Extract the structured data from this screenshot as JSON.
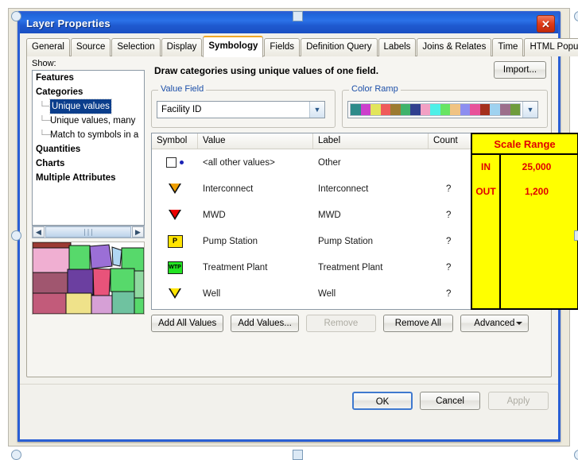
{
  "window": {
    "title": "Layer Properties",
    "close_icon": "close-icon"
  },
  "tabs": [
    {
      "label": "General",
      "active": false
    },
    {
      "label": "Source",
      "active": false
    },
    {
      "label": "Selection",
      "active": false
    },
    {
      "label": "Display",
      "active": false
    },
    {
      "label": "Symbology",
      "active": true
    },
    {
      "label": "Fields",
      "active": false
    },
    {
      "label": "Definition Query",
      "active": false
    },
    {
      "label": "Labels",
      "active": false
    },
    {
      "label": "Joins & Relates",
      "active": false
    },
    {
      "label": "Time",
      "active": false
    },
    {
      "label": "HTML Popup",
      "active": false
    }
  ],
  "show_panel": {
    "caption": "Show:",
    "items": [
      {
        "label": "Features",
        "type": "group",
        "selected": false
      },
      {
        "label": "Categories",
        "type": "group",
        "selected": false
      },
      {
        "label": "Unique values",
        "type": "child",
        "selected": true
      },
      {
        "label": "Unique values, many",
        "type": "child",
        "selected": false
      },
      {
        "label": "Match to symbols in a",
        "type": "child",
        "selected": false
      },
      {
        "label": "Quantities",
        "type": "group",
        "selected": false
      },
      {
        "label": "Charts",
        "type": "group",
        "selected": false
      },
      {
        "label": "Multiple Attributes",
        "type": "group",
        "selected": false
      }
    ],
    "scrollbar": {
      "left_arrow": "◀",
      "right_arrow": "▶",
      "thumb_grip": "∣∣∣"
    }
  },
  "symbology": {
    "description": "Draw categories using unique values of one field.",
    "import_button": "Import...",
    "value_field": {
      "legend": "Value Field",
      "selected": "Facility ID",
      "arrow": "⌵"
    },
    "color_ramp": {
      "legend": "Color Ramp",
      "arrow": "⌵",
      "colors": [
        "#2d8a8a",
        "#cc3fcc",
        "#e2e55c",
        "#ef5b5b",
        "#9c7b32",
        "#3fb36b",
        "#2f3f8f",
        "#f2a0c4",
        "#4ef0e8",
        "#67e564",
        "#f0c383",
        "#8c8ef0",
        "#e8529a",
        "#a5301c",
        "#9fd2f0",
        "#9c6f8c",
        "#6f9c3c"
      ]
    },
    "table": {
      "headers": [
        "Symbol",
        "Value",
        "Label",
        "Count"
      ],
      "rows": [
        {
          "symbol": "checkbox-dot",
          "value": "<all other values>",
          "label": "Other",
          "count": "",
          "color": "#1a22b5"
        },
        {
          "symbol": "triangle-down",
          "value": "Interconnect",
          "label": "Interconnect",
          "count": "?",
          "color": "#f0a000"
        },
        {
          "symbol": "triangle-down",
          "value": "MWD",
          "label": "MWD",
          "count": "?",
          "color": "#ee0000"
        },
        {
          "symbol": "square-p",
          "value": "Pump Station",
          "label": "Pump Station",
          "count": "?",
          "color": "#ffe400",
          "text": "P"
        },
        {
          "symbol": "square-wtp",
          "value": "Treatment Plant",
          "label": "Treatment Plant",
          "count": "?",
          "color": "#22e322",
          "text": "WTP"
        },
        {
          "symbol": "triangle-down",
          "value": "Well",
          "label": "Well",
          "count": "?",
          "color": "#ffe400"
        }
      ]
    },
    "scale_range": {
      "title": "Scale Range",
      "rows": [
        {
          "key": "IN",
          "value": "25,000"
        },
        {
          "key": "OUT",
          "value": "1,200"
        }
      ],
      "background": "#ffff00",
      "text_color": "#e00000"
    },
    "actions": [
      {
        "label": "Add All Values",
        "id": "add-all-values",
        "disabled": false
      },
      {
        "label": "Add Values...",
        "id": "add-values",
        "disabled": false
      },
      {
        "label": "Remove",
        "id": "remove",
        "disabled": true
      },
      {
        "label": "Remove All",
        "id": "remove-all",
        "disabled": false
      },
      {
        "label": "Advanced",
        "id": "advanced",
        "disabled": false
      }
    ]
  },
  "footer": {
    "ok": "OK",
    "cancel": "Cancel",
    "apply": "Apply"
  }
}
